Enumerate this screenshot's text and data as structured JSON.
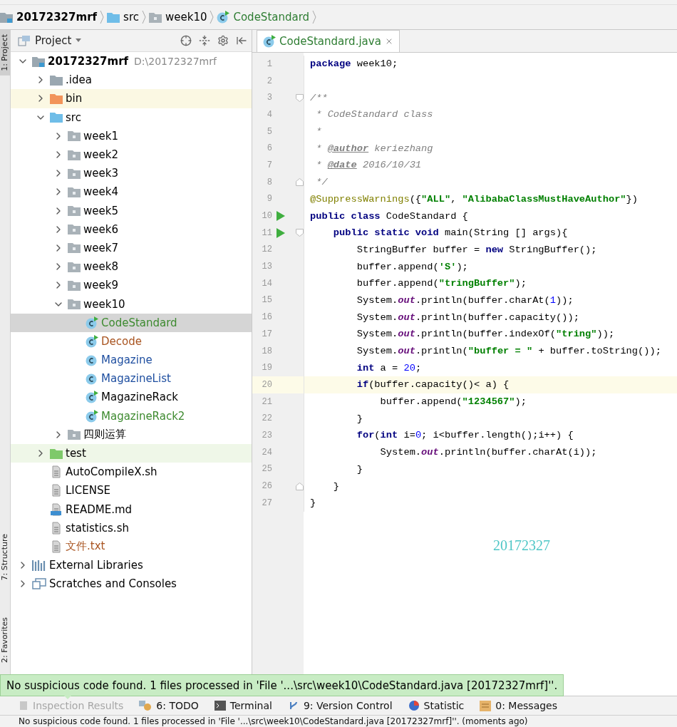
{
  "breadcrumbs": [
    {
      "label": "20172327mrf",
      "kind": "module"
    },
    {
      "label": "src",
      "kind": "folder-source"
    },
    {
      "label": "week10",
      "kind": "package"
    },
    {
      "label": "CodeStandard",
      "kind": "class"
    }
  ],
  "side_tabs": [
    {
      "label": "1: Project",
      "selected": true
    },
    {
      "label": "7: Structure",
      "selected": false
    },
    {
      "label": "2: Favorites",
      "selected": false
    }
  ],
  "project_panel": {
    "title": "Project",
    "tree": [
      {
        "label": "20172327mrf",
        "path": "D:\\20172327mrf",
        "kind": "module",
        "expanded": true,
        "selected": false,
        "color": "#000000",
        "children": [
          {
            "label": ".idea",
            "kind": "folder",
            "expanded": false,
            "selected": false,
            "color": "#000000"
          },
          {
            "label": "bin",
            "kind": "folder-excluded",
            "expanded": false,
            "selected": false,
            "color": "#000000"
          },
          {
            "label": "src",
            "kind": "folder-source",
            "expanded": true,
            "selected": false,
            "color": "#000000",
            "children": [
              {
                "label": "week1",
                "kind": "package",
                "expanded": false,
                "selected": false,
                "color": "#000000"
              },
              {
                "label": "week2",
                "kind": "package",
                "expanded": false,
                "selected": false,
                "color": "#000000"
              },
              {
                "label": "week3",
                "kind": "package",
                "expanded": false,
                "selected": false,
                "color": "#000000"
              },
              {
                "label": "week4",
                "kind": "package",
                "expanded": false,
                "selected": false,
                "color": "#000000"
              },
              {
                "label": "week5",
                "kind": "package",
                "expanded": false,
                "selected": false,
                "color": "#000000"
              },
              {
                "label": "week6",
                "kind": "package",
                "expanded": false,
                "selected": false,
                "color": "#000000"
              },
              {
                "label": "week7",
                "kind": "package",
                "expanded": false,
                "selected": false,
                "color": "#000000"
              },
              {
                "label": "week8",
                "kind": "package",
                "expanded": false,
                "selected": false,
                "color": "#000000"
              },
              {
                "label": "week9",
                "kind": "package",
                "expanded": false,
                "selected": false,
                "color": "#000000"
              },
              {
                "label": "week10",
                "kind": "package",
                "expanded": true,
                "selected": false,
                "color": "#000000",
                "children": [
                  {
                    "label": "CodeStandard",
                    "kind": "class",
                    "runnable": true,
                    "selected": true,
                    "color": "#3d8a2f"
                  },
                  {
                    "label": "Decode",
                    "kind": "class",
                    "runnable": true,
                    "selected": false,
                    "color": "#a8531f"
                  },
                  {
                    "label": "Magazine",
                    "kind": "class",
                    "runnable": false,
                    "selected": false,
                    "color": "#1f4fa0"
                  },
                  {
                    "label": "MagazineList",
                    "kind": "class",
                    "runnable": false,
                    "selected": false,
                    "color": "#1f4fa0"
                  },
                  {
                    "label": "MagazineRack",
                    "kind": "class",
                    "runnable": true,
                    "selected": false,
                    "color": "#000000"
                  },
                  {
                    "label": "MagazineRack2",
                    "kind": "class",
                    "runnable": true,
                    "selected": false,
                    "color": "#3d8a2f"
                  }
                ]
              },
              {
                "label": "四则运算",
                "kind": "package",
                "expanded": false,
                "selected": false,
                "color": "#000000"
              }
            ]
          },
          {
            "label": "test",
            "kind": "folder-test",
            "expanded": false,
            "selected": false,
            "color": "#000000"
          },
          {
            "label": "AutoCompileX.sh",
            "kind": "file",
            "selected": false,
            "color": "#000000"
          },
          {
            "label": "LICENSE",
            "kind": "file",
            "selected": false,
            "color": "#000000"
          },
          {
            "label": "README.md",
            "kind": "markdown",
            "selected": false,
            "color": "#000000"
          },
          {
            "label": "statistics.sh",
            "kind": "file",
            "selected": false,
            "color": "#000000"
          },
          {
            "label": "文件.txt",
            "kind": "file",
            "selected": false,
            "color": "#a8531f"
          }
        ]
      },
      {
        "label": "External Libraries",
        "kind": "library",
        "expanded": false,
        "selected": false,
        "color": "#000000"
      },
      {
        "label": "Scratches and Consoles",
        "kind": "scratches",
        "expanded": false,
        "selected": false,
        "color": "#000000"
      }
    ]
  },
  "editor": {
    "tab": {
      "label": "CodeStandard.java",
      "selected": true
    },
    "lines": [
      {
        "number": "1",
        "run": false,
        "current": false,
        "fold_start": false,
        "fold_end": false,
        "tokens": [
          {
            "kind": "kw",
            "text": "package"
          },
          {
            "kind": "plain",
            "text": " week10;"
          }
        ]
      },
      {
        "number": "2",
        "run": false,
        "current": false,
        "fold_start": false,
        "fold_end": false
      },
      {
        "number": "3",
        "run": false,
        "current": false,
        "fold_start": true,
        "fold_end": false,
        "tokens": [
          {
            "kind": "comment",
            "text": "/**"
          }
        ]
      },
      {
        "number": "4",
        "run": false,
        "current": false,
        "fold_start": false,
        "fold_end": false,
        "tokens": [
          {
            "kind": "comment",
            "text": " * CodeStandard class"
          }
        ]
      },
      {
        "number": "5",
        "run": false,
        "current": false,
        "fold_start": false,
        "fold_end": false,
        "tokens": [
          {
            "kind": "comment",
            "text": " *"
          }
        ]
      },
      {
        "number": "6",
        "run": false,
        "current": false,
        "fold_start": false,
        "fold_end": false,
        "tokens": [
          {
            "kind": "comment",
            "text": " * "
          },
          {
            "kind": "doctag",
            "text": "@author"
          },
          {
            "kind": "comment",
            "text": " keriezhang"
          }
        ]
      },
      {
        "number": "7",
        "run": false,
        "current": false,
        "fold_start": false,
        "fold_end": false,
        "tokens": [
          {
            "kind": "comment",
            "text": " * "
          },
          {
            "kind": "doctag",
            "text": "@date"
          },
          {
            "kind": "comment",
            "text": " 2016/10/31"
          }
        ]
      },
      {
        "number": "8",
        "run": false,
        "current": false,
        "fold_start": false,
        "fold_end": true,
        "tokens": [
          {
            "kind": "comment",
            "text": " */"
          }
        ]
      },
      {
        "number": "9",
        "run": false,
        "current": false,
        "fold_start": false,
        "fold_end": false,
        "tokens": [
          {
            "kind": "ann",
            "text": "@SuppressWarnings"
          },
          {
            "kind": "plain",
            "text": "({"
          },
          {
            "kind": "str",
            "text": "\"ALL\""
          },
          {
            "kind": "plain",
            "text": ", "
          },
          {
            "kind": "str",
            "text": "\"AlibabaClassMustHaveAuthor\""
          },
          {
            "kind": "plain",
            "text": "})"
          }
        ]
      },
      {
        "number": "10",
        "run": true,
        "current": false,
        "fold_start": false,
        "fold_end": false,
        "tokens": [
          {
            "kind": "kw",
            "text": "public class"
          },
          {
            "kind": "plain",
            "text": " CodeStandard {"
          }
        ]
      },
      {
        "number": "11",
        "run": true,
        "current": false,
        "fold_start": true,
        "fold_end": false,
        "tokens": [
          {
            "kind": "kw",
            "text": "    public static void"
          },
          {
            "kind": "plain",
            "text": " main(String [] args){"
          }
        ]
      },
      {
        "number": "12",
        "run": false,
        "current": false,
        "fold_start": false,
        "fold_end": false,
        "tokens": [
          {
            "kind": "plain",
            "text": "        StringBuffer buffer = "
          },
          {
            "kind": "kw",
            "text": "new"
          },
          {
            "kind": "plain",
            "text": " StringBuffer();"
          }
        ]
      },
      {
        "number": "13",
        "run": false,
        "current": false,
        "fold_start": false,
        "fold_end": false,
        "tokens": [
          {
            "kind": "plain",
            "text": "        buffer.append("
          },
          {
            "kind": "str",
            "text": "'S'"
          },
          {
            "kind": "plain",
            "text": ");"
          }
        ]
      },
      {
        "number": "14",
        "run": false,
        "current": false,
        "fold_start": false,
        "fold_end": false,
        "tokens": [
          {
            "kind": "plain",
            "text": "        buffer.append("
          },
          {
            "kind": "str",
            "text": "\"tringBuffer\""
          },
          {
            "kind": "plain",
            "text": ");"
          }
        ]
      },
      {
        "number": "15",
        "run": false,
        "current": false,
        "fold_start": false,
        "fold_end": false,
        "tokens": [
          {
            "kind": "plain",
            "text": "        System."
          },
          {
            "kind": "field",
            "text": "out"
          },
          {
            "kind": "plain",
            "text": ".println(buffer.charAt("
          },
          {
            "kind": "num",
            "text": "1"
          },
          {
            "kind": "plain",
            "text": "));"
          }
        ]
      },
      {
        "number": "16",
        "run": false,
        "current": false,
        "fold_start": false,
        "fold_end": false,
        "tokens": [
          {
            "kind": "plain",
            "text": "        System."
          },
          {
            "kind": "field",
            "text": "out"
          },
          {
            "kind": "plain",
            "text": ".println(buffer.capacity());"
          }
        ]
      },
      {
        "number": "17",
        "run": false,
        "current": false,
        "fold_start": false,
        "fold_end": false,
        "tokens": [
          {
            "kind": "plain",
            "text": "        System."
          },
          {
            "kind": "field",
            "text": "out"
          },
          {
            "kind": "plain",
            "text": ".println(buffer.indexOf("
          },
          {
            "kind": "str",
            "text": "\"tring\""
          },
          {
            "kind": "plain",
            "text": "));"
          }
        ]
      },
      {
        "number": "18",
        "run": false,
        "current": false,
        "fold_start": false,
        "fold_end": false,
        "tokens": [
          {
            "kind": "plain",
            "text": "        System."
          },
          {
            "kind": "field",
            "text": "out"
          },
          {
            "kind": "plain",
            "text": ".println("
          },
          {
            "kind": "str",
            "text": "\"buffer = \""
          },
          {
            "kind": "plain",
            "text": " + buffer.toString());"
          }
        ]
      },
      {
        "number": "19",
        "run": false,
        "current": false,
        "fold_start": false,
        "fold_end": false,
        "tokens": [
          {
            "kind": "kw",
            "text": "        int"
          },
          {
            "kind": "plain",
            "text": " a = "
          },
          {
            "kind": "num",
            "text": "20"
          },
          {
            "kind": "plain",
            "text": ";"
          }
        ]
      },
      {
        "number": "20",
        "run": false,
        "current": true,
        "fold_start": false,
        "fold_end": false,
        "tokens": [
          {
            "kind": "kw",
            "text": "        if"
          },
          {
            "kind": "plain",
            "text": "(buffer.capacity()< a) {"
          }
        ]
      },
      {
        "number": "21",
        "run": false,
        "current": false,
        "fold_start": false,
        "fold_end": false,
        "tokens": [
          {
            "kind": "plain",
            "text": "            buffer.append("
          },
          {
            "kind": "str",
            "text": "\"1234567\""
          },
          {
            "kind": "plain",
            "text": ");"
          }
        ]
      },
      {
        "number": "22",
        "run": false,
        "current": false,
        "fold_start": false,
        "fold_end": false,
        "tokens": [
          {
            "kind": "plain",
            "text": "        }"
          }
        ]
      },
      {
        "number": "23",
        "run": false,
        "current": false,
        "fold_start": false,
        "fold_end": false,
        "tokens": [
          {
            "kind": "kw",
            "text": "        for"
          },
          {
            "kind": "plain",
            "text": "("
          },
          {
            "kind": "kw",
            "text": "int"
          },
          {
            "kind": "plain",
            "text": " i="
          },
          {
            "kind": "num",
            "text": "0"
          },
          {
            "kind": "plain",
            "text": "; i<buffer.length();i++) {"
          }
        ]
      },
      {
        "number": "24",
        "run": false,
        "current": false,
        "fold_start": false,
        "fold_end": false,
        "tokens": [
          {
            "kind": "plain",
            "text": "            System."
          },
          {
            "kind": "field",
            "text": "out"
          },
          {
            "kind": "plain",
            "text": ".println(buffer.charAt(i));"
          }
        ]
      },
      {
        "number": "25",
        "run": false,
        "current": false,
        "fold_start": false,
        "fold_end": false,
        "tokens": [
          {
            "kind": "plain",
            "text": "        }"
          }
        ]
      },
      {
        "number": "26",
        "run": false,
        "current": false,
        "fold_start": false,
        "fold_end": true,
        "tokens": [
          {
            "kind": "plain",
            "text": "    }"
          }
        ]
      },
      {
        "number": "27",
        "run": false,
        "current": false,
        "fold_start": false,
        "fold_end": false,
        "tokens": [
          {
            "kind": "plain",
            "text": "}"
          }
        ]
      }
    ],
    "overlay_text": "20172327"
  },
  "notification": "No suspicious code found. 1 files processed in 'File '...\\src\\week10\\CodeStandard.java [20172327mrf]''.",
  "tool_windows": [
    {
      "label": "Inspection Results",
      "kind": "inspection",
      "disabled": true
    },
    {
      "label": "6: TODO",
      "kind": "todo",
      "disabled": false
    },
    {
      "label": "Terminal",
      "kind": "terminal",
      "disabled": false
    },
    {
      "label": "9: Version Control",
      "kind": "vcs",
      "disabled": false
    },
    {
      "label": "Statistic",
      "kind": "statistic",
      "disabled": false
    },
    {
      "label": "0: Messages",
      "kind": "messages",
      "disabled": false
    }
  ],
  "status_bar": "No suspicious code found. 1 files processed in 'File '...\\src\\week10\\CodeStandard.java [20172327mrf]''. (moments ago)"
}
